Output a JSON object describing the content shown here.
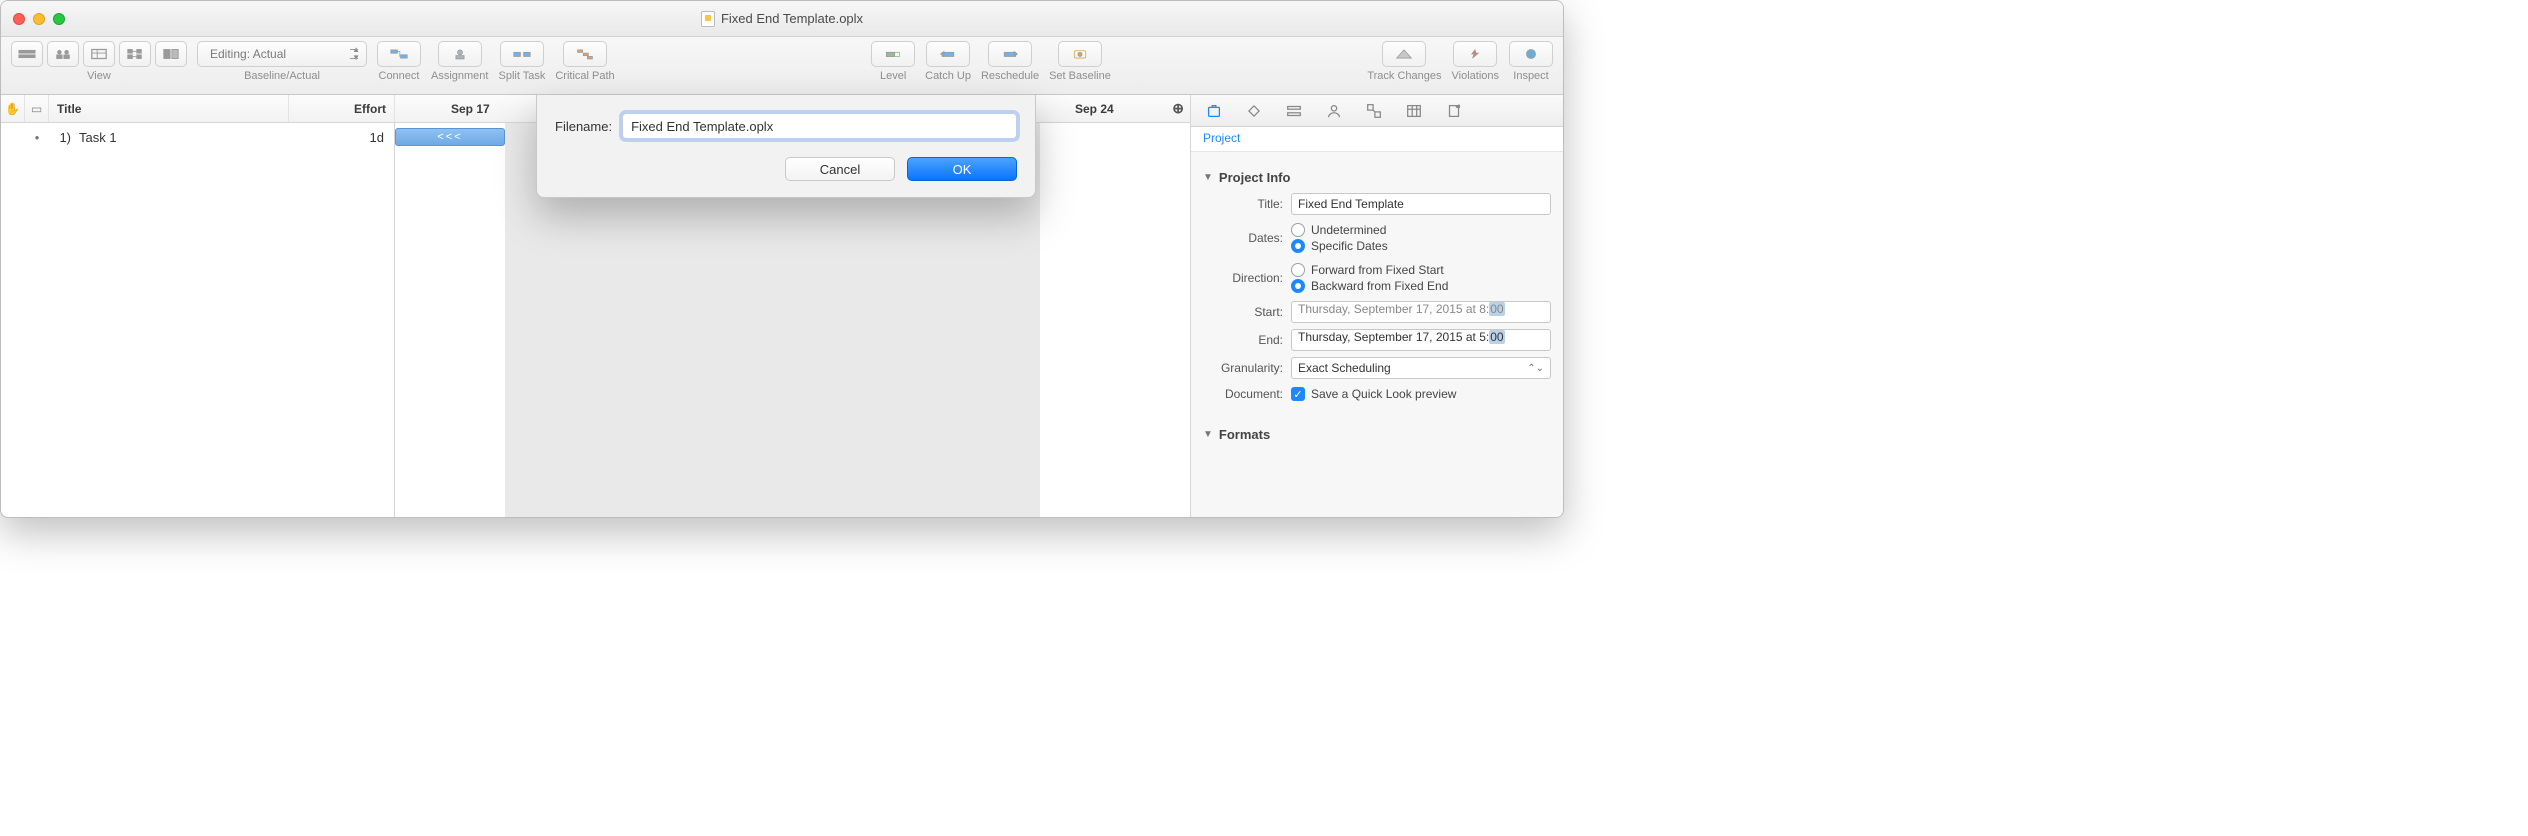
{
  "window": {
    "title": "Fixed End Template.oplx"
  },
  "toolbar": {
    "view_label": "View",
    "baseline_dropdown": "Editing: Actual",
    "baseline_label": "Baseline/Actual",
    "connect": "Connect",
    "assignment": "Assignment",
    "split_task": "Split Task",
    "critical_path": "Critical Path",
    "level": "Level",
    "catch_up": "Catch Up",
    "reschedule": "Reschedule",
    "set_baseline": "Set Baseline",
    "track_changes": "Track Changes",
    "violations": "Violations",
    "inspect": "Inspect"
  },
  "columns": {
    "title": "Title",
    "effort": "Effort"
  },
  "gantt": {
    "date1": "Sep 17",
    "date2": "Sep 24",
    "bar_label": "<<<"
  },
  "tasks": [
    {
      "index": "1)",
      "name": "Task 1",
      "effort": "1d"
    }
  ],
  "dialog": {
    "label": "Filename:",
    "value": "Fixed End Template.oplx",
    "cancel": "Cancel",
    "ok": "OK"
  },
  "inspector": {
    "tab_label": "Project",
    "section_project_info": "Project Info",
    "section_formats": "Formats",
    "title_label": "Title:",
    "title_value": "Fixed End Template",
    "dates_label": "Dates:",
    "dates_undetermined": "Undetermined",
    "dates_specific": "Specific Dates",
    "direction_label": "Direction:",
    "direction_forward": "Forward from Fixed Start",
    "direction_backward": "Backward from Fixed End",
    "start_label": "Start:",
    "start_value_pre": "Thursday, September 17, 2015 at 8:",
    "start_value_hl": "00",
    "end_label": "End:",
    "end_value_pre": "Thursday, September 17, 2015 at 5:",
    "end_value_hl": "00",
    "granularity_label": "Granularity:",
    "granularity_value": "Exact Scheduling",
    "document_label": "Document:",
    "document_check": "Save a Quick Look preview"
  }
}
